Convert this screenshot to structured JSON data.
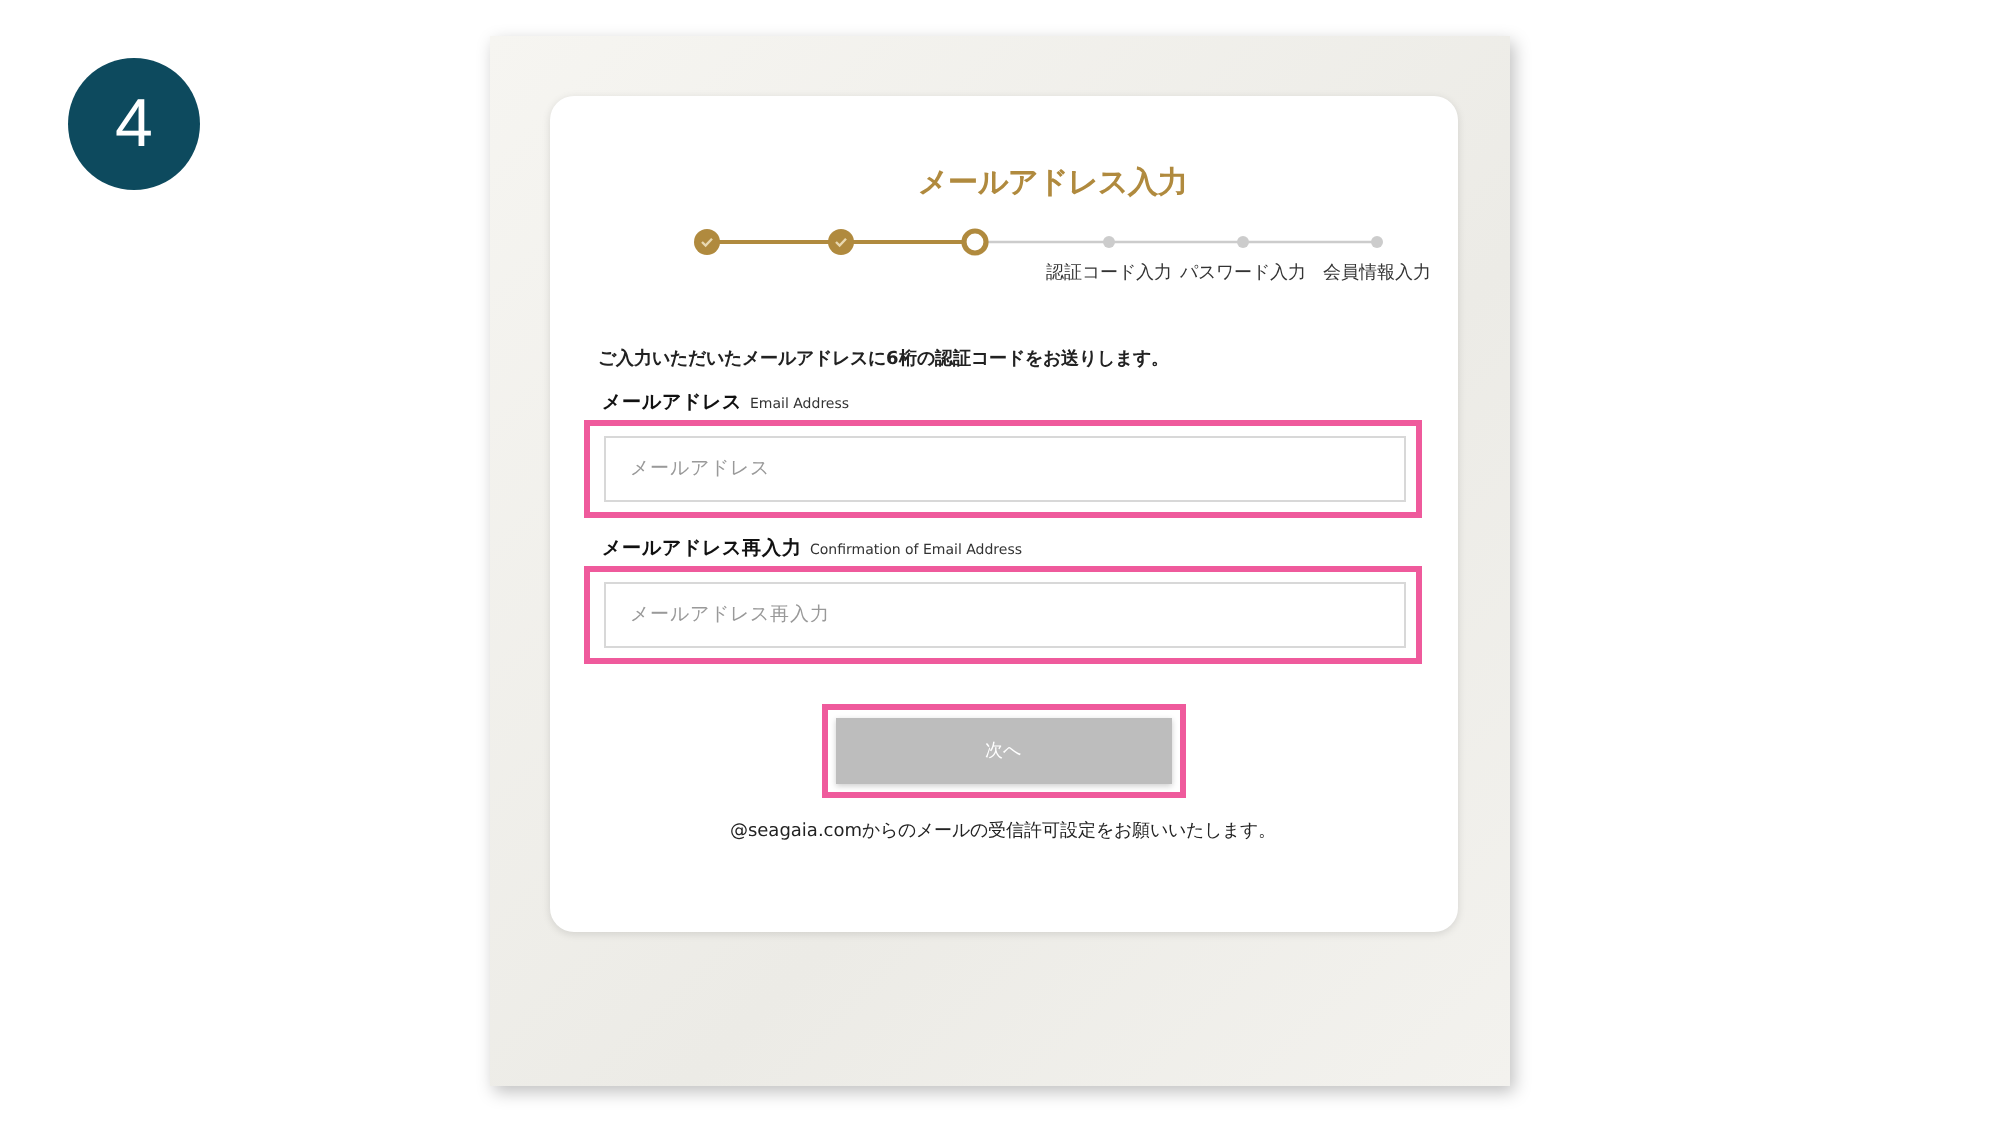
{
  "badge": "4",
  "title": "メールアドレス入力",
  "steps": [
    {
      "kind": "done"
    },
    {
      "kind": "done"
    },
    {
      "kind": "current"
    },
    {
      "label": "認証コード入力",
      "kind": "upcoming"
    },
    {
      "label": "パスワード入力",
      "kind": "upcoming"
    },
    {
      "label": "会員情報入力",
      "kind": "upcoming"
    }
  ],
  "intro": "ご入力いただいたメールアドレスに6桁の認証コードをお送りします。",
  "fields": [
    {
      "label": "メールアドレス",
      "sublabel": "Email Address",
      "placeholder": "メールアドレス",
      "highlighted": true
    },
    {
      "label": "メールアドレス再入力",
      "sublabel": "Confirmation of Email Address",
      "placeholder": "メールアドレス再入力",
      "highlighted": true
    }
  ],
  "next_button": {
    "label": "次へ",
    "disabled": true,
    "highlighted": true
  },
  "note": "@seagaia.comからのメールの受信許可設定をお願いいたします。"
}
